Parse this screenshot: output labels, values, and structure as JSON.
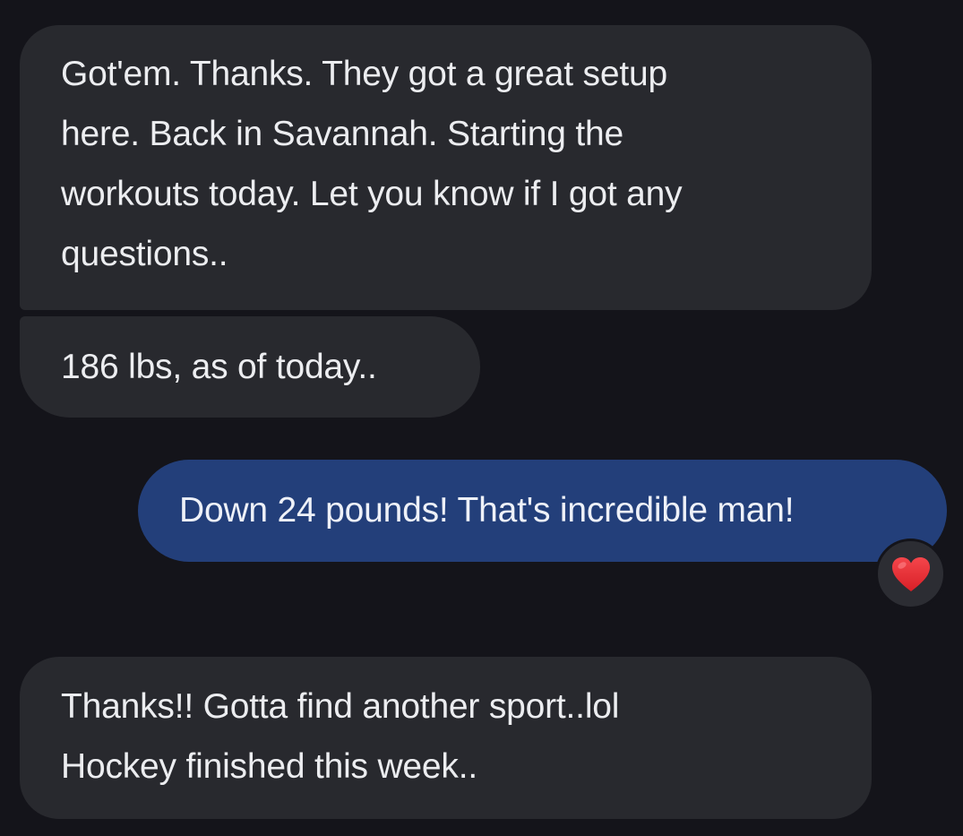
{
  "messages": [
    {
      "direction": "incoming",
      "lines": [
        "Got'em. Thanks. They got a great setup",
        "here. Back in Savannah. Starting the",
        "workouts today. Let you know if I got any",
        "questions.."
      ]
    },
    {
      "direction": "incoming",
      "lines": [
        "186 lbs, as of today.."
      ]
    },
    {
      "direction": "outgoing",
      "lines": [
        "Down 24 pounds! That's incredible man!"
      ],
      "reaction": {
        "icon": "red-heart-icon"
      }
    },
    {
      "direction": "incoming",
      "lines": [
        "Thanks!! Gotta find another sport..lol",
        "Hockey finished this week.."
      ]
    }
  ],
  "colors": {
    "background": "#14141a",
    "incoming_bubble": "#28292e",
    "outgoing_bubble": "#233f7a",
    "reaction_heart": "#e8282f"
  }
}
